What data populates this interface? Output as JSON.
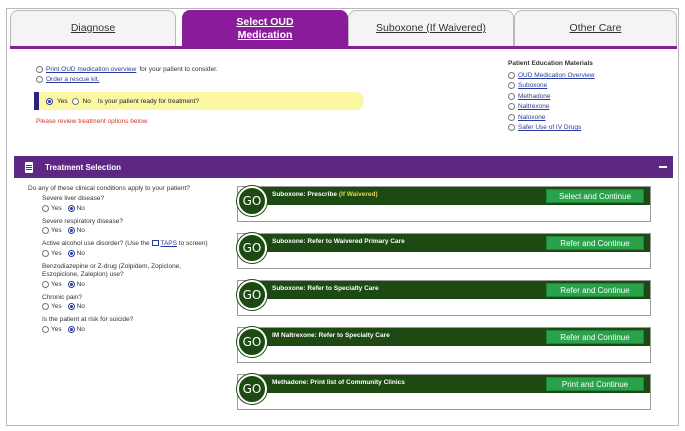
{
  "tabs": [
    {
      "label": "Diagnose",
      "active": false
    },
    {
      "label": "Select OUD Medication",
      "active": true
    },
    {
      "label": "Suboxone (If Waivered)",
      "active": false
    },
    {
      "label": "Other Care",
      "active": false
    }
  ],
  "top": {
    "print_link": "Print OUD medication overview",
    "print_suffix": "for your patient to consider.",
    "rescue_link": "Order a rescue kit.",
    "ready_yes": "Yes",
    "ready_no": "No",
    "ready_question": "Is your patient ready for treatment?",
    "warning": "Please review treatment options below."
  },
  "education": {
    "title": "Patient Education Materials",
    "items": [
      "OUD Medication Overview",
      "Suboxone",
      "Methadone",
      "Naltrexone",
      "Naloxone",
      "Safer Use of IV Drugs"
    ]
  },
  "treatment": {
    "title": "Treatment Selection",
    "intro": "Do any of these clinical conditions apply to your patient?",
    "yes_label": "Yes",
    "no_label": "No",
    "questions": [
      {
        "text": "Severe liver disease?"
      },
      {
        "text": "Severe respiratory disease?"
      },
      {
        "text_a": "Active alcohol use disorder? (Use the",
        "link": "TAPS",
        "text_b": "to screen)"
      },
      {
        "text": "Benzodiazepine or Z-drug (Zolpidem, Zopiclone, Eszopiclone, Zaleplon) use?"
      },
      {
        "text": "Chronic pain?"
      },
      {
        "text": "Is the patient at risk for suicide?"
      }
    ],
    "go_label": "GO",
    "options": [
      {
        "title": "Suboxone: Prescribe",
        "highlight": "(If Waivered)",
        "button": "Select and Continue"
      },
      {
        "title": "Suboxone: Refer to Waivered Primary Care",
        "button": "Refer and Continue"
      },
      {
        "title": "Suboxone: Refer to Specialty Care",
        "button": "Refer and Continue"
      },
      {
        "title": "IM Naltrexone: Refer to Specialty Care",
        "button": "Refer and Continue"
      },
      {
        "title": "Methadone: Print list of Community Clinics",
        "button": "Print and Continue"
      }
    ]
  },
  "colors": {
    "tab_active": "#8a1c9c",
    "section_header": "#5e2784",
    "go_dark_green": "#1c4a12",
    "button_green": "#2aa14b",
    "ready_bar": "#fbf7a2",
    "warning_red": "#d9342b"
  }
}
